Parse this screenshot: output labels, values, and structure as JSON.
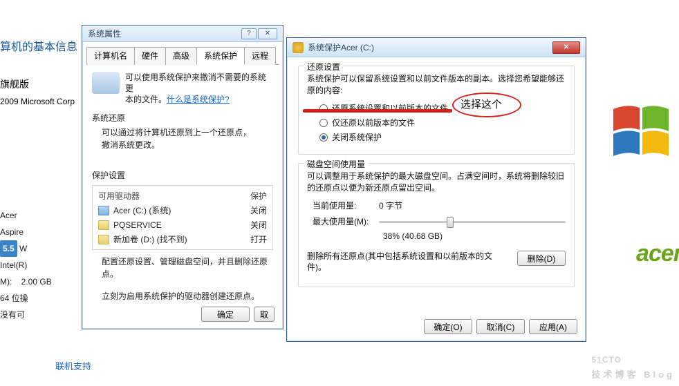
{
  "page": {
    "title": "算机的基本信息",
    "edition": "旗舰版",
    "copyright": "2009 Microsoft Corp",
    "rows": {
      "r1": "Acer",
      "r2": "Aspire",
      "r3_badge": "5.5",
      "r3_rest": "W",
      "r4": "Intel(R)",
      "r5_label": "M):",
      "r5_val": "2.00 GB",
      "r6": "64 位操",
      "r7": "没有可"
    },
    "link": "联机支持"
  },
  "dlg1": {
    "title": "系统属性",
    "tabs": [
      "计算机名",
      "硬件",
      "高级",
      "系统保护",
      "远程"
    ],
    "active_tab": 3,
    "info1": "可以使用系统保护来撤消不需要的系统更",
    "info2": "本的文件。",
    "info_link": "什么是系统保护?",
    "restore_title": "系统还原",
    "restore_text1": "可以通过将计算机还原到上一个还原点，",
    "restore_text2": "撤消系统更改。",
    "protect_title": "保护设置",
    "col1": "可用驱动器",
    "col2": "保护",
    "drives": [
      {
        "name": "Acer (C:) (系统)",
        "state": "关闭"
      },
      {
        "name": "PQSERVICE",
        "state": "关闭"
      },
      {
        "name": "新加卷 (D:) (找不到)",
        "state": "打开"
      }
    ],
    "cfg_text": "配置还原设置、管理磁盘空间，并且删除还原点。",
    "create_text": "立刻为启用系统保护的驱动器创建还原点。",
    "btn_ok": "确定",
    "btn_cancel": "取"
  },
  "dlg2": {
    "title": "系统保护Acer (C:)",
    "g1_legend": "还原设置",
    "g1_text": "系统保护可以保留系统设置和以前文件版本的副本。选择您希望能够还原的内容:",
    "opt1": "还原系统设置和以前版本的文件",
    "opt2": "仅还原以前版本的文件",
    "opt3": "关闭系统保护",
    "annotation": "选择这个",
    "g2_legend": "磁盘空间使用量",
    "g2_text": "可以调整用于系统保护的最大磁盘空间。占满空间时，系统将删除较旧的还原点以便为新还原点留出空间。",
    "cur_label": "当前使用量:",
    "cur_val": "0 字节",
    "max_label": "最大使用量(M):",
    "slider_pct": 38,
    "slider_text": "38% (40.68 GB)",
    "del_text": "删除所有还原点(其中包括系统设置和以前版本的文件)。",
    "btn_del": "删除(D)",
    "btn_ok": "确定(O)",
    "btn_cancel": "取消(C)",
    "btn_apply": "应用(A)"
  },
  "brand": {
    "acer": "acer",
    "watermark": "51CTO",
    "watermark_sub": "技术博客 Blog"
  }
}
